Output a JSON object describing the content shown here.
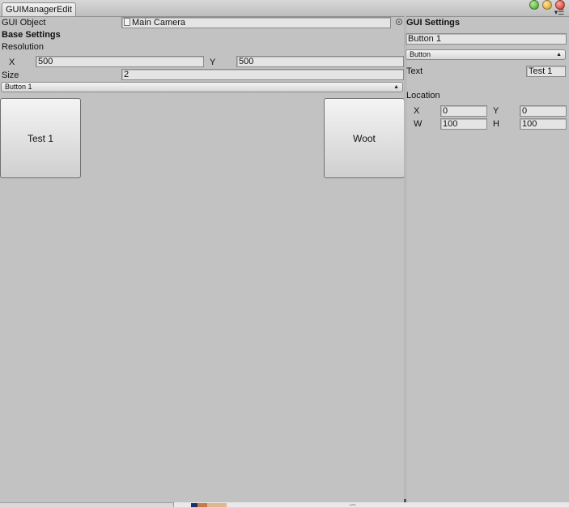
{
  "window": {
    "tab_title": "GUIManagerEdit",
    "panel_menu_icon": "panel-menu-icon"
  },
  "left": {
    "gui_object_label": "GUI Object",
    "gui_object_value": "Main Camera",
    "base_settings_label": "Base Settings",
    "resolution_label": "Resolution",
    "res_x_label": "X",
    "res_x_value": "500",
    "res_y_label": "Y",
    "res_y_value": "500",
    "size_label": "Size",
    "size_value": "2",
    "element_dropdown_value": "Button 1",
    "preview_buttons": [
      {
        "label": "Test 1"
      },
      {
        "label": "Woot"
      }
    ]
  },
  "right": {
    "header": "GUI Settings",
    "name_value": "Button 1",
    "type_dropdown_value": "Button",
    "text_label": "Text",
    "text_value": "Test 1",
    "location_label": "Location",
    "x_label": "X",
    "x_value": "0",
    "y_label": "Y",
    "y_value": "0",
    "w_label": "W",
    "w_value": "100",
    "h_label": "H",
    "h_value": "100"
  },
  "colors": {
    "panel_bg": "#c2c2c2",
    "field_bg": "#e4e4e4",
    "button_gradient_top": "#f4f4f4",
    "button_gradient_bottom": "#cfcfcf"
  }
}
